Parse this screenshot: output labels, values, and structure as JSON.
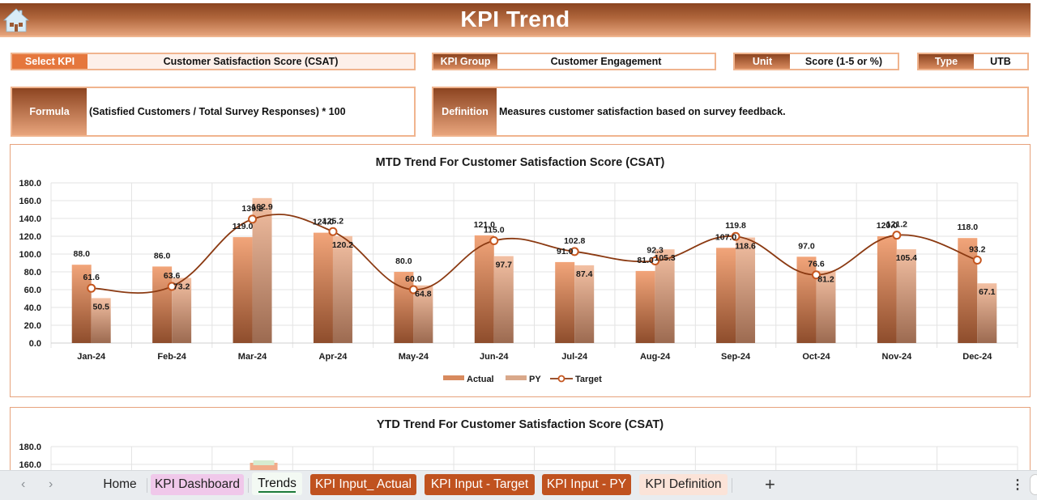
{
  "header": {
    "title": "KPI Trend",
    "home_icon": "home-icon"
  },
  "selectors": {
    "select_kpi": {
      "label": "Select KPI",
      "value": "Customer Satisfaction Score (CSAT)"
    },
    "kpi_group": {
      "label": "KPI Group",
      "value": "Customer Engagement"
    },
    "unit": {
      "label": "Unit",
      "value": "Score (1-5 or %)"
    },
    "type": {
      "label": "Type",
      "value": "UTB"
    }
  },
  "formula": {
    "label": "Formula",
    "value": "(Satisfied Customers / Total Survey Responses) * 100"
  },
  "definition": {
    "label": "Definition",
    "value": "Measures customer satisfaction based on survey feedback."
  },
  "colors": {
    "accent": "#e5773d",
    "brown": "#8c4420",
    "target_line": "#8b3a12",
    "tab_brown": "#c0521f",
    "panel_border": "#e7a27c"
  },
  "chart_data": [
    {
      "type": "bar",
      "title": "MTD Trend For Customer Satisfaction Score (CSAT)",
      "xlabel": "",
      "ylabel": "",
      "ylim": [
        0,
        180
      ],
      "yticks": [
        "0.0",
        "20.0",
        "40.0",
        "60.0",
        "80.0",
        "100.0",
        "120.0",
        "140.0",
        "160.0",
        "180.0"
      ],
      "grid": true,
      "legend": "bottom",
      "categories": [
        "Jan-24",
        "Feb-24",
        "Mar-24",
        "Apr-24",
        "May-24",
        "Jun-24",
        "Jul-24",
        "Aug-24",
        "Sep-24",
        "Oct-24",
        "Nov-24",
        "Dec-24"
      ],
      "series": [
        {
          "name": "Actual",
          "kind": "bar",
          "values": [
            88.0,
            86.0,
            119.0,
            124.0,
            80.0,
            121.0,
            91.0,
            81.0,
            107.0,
            97.0,
            120.0,
            118.0
          ]
        },
        {
          "name": "PY",
          "kind": "bar",
          "values": [
            50.5,
            73.2,
            162.9,
            120.2,
            64.8,
            97.7,
            87.4,
            105.3,
            118.6,
            81.2,
            105.4,
            67.1
          ]
        },
        {
          "name": "Target",
          "kind": "line",
          "values": [
            61.6,
            63.6,
            139.2,
            125.2,
            60.0,
            115.0,
            102.8,
            92.3,
            119.8,
            76.6,
            121.2,
            93.2
          ]
        }
      ]
    },
    {
      "type": "bar",
      "title": "YTD Trend For Customer Satisfaction Score (CSAT)",
      "ylim": [
        0,
        180
      ],
      "yticks_visible": [
        "160.0",
        "180.0"
      ],
      "grid": true,
      "note": "chart partially visible; cut off by sheet tab bar"
    }
  ],
  "legend": {
    "actual": "Actual",
    "py": "PY",
    "target": "Target"
  },
  "sheet_tabs": {
    "nav_prev": "‹",
    "nav_next": "›",
    "tabs": [
      {
        "label": "Home",
        "style": "plain"
      },
      {
        "label": "KPI Dashboard",
        "style": "pink"
      },
      {
        "label": "Trends",
        "style": "active"
      },
      {
        "label": "KPI Input_ Actual",
        "style": "brown"
      },
      {
        "label": "KPI Input - Target",
        "style": "brown"
      },
      {
        "label": "KPI Input - PY",
        "style": "brown"
      },
      {
        "label": "KPI Definition",
        "style": "peach"
      }
    ],
    "add_sheet": "+",
    "more": "⋮"
  }
}
